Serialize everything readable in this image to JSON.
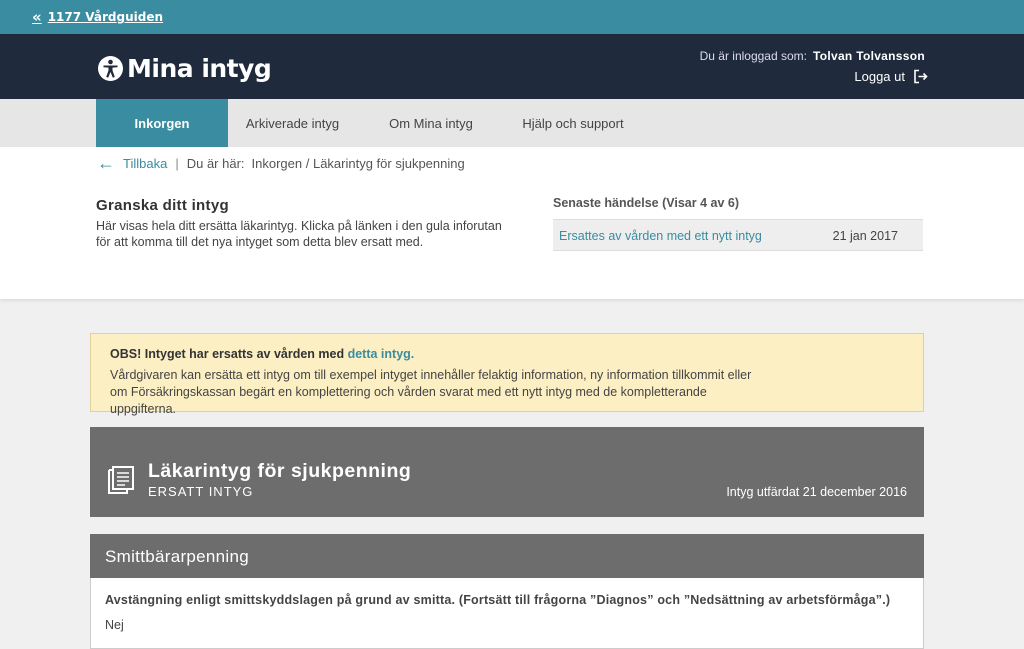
{
  "topbar": {
    "back_label": "1177 Vårdguiden"
  },
  "header": {
    "logo_text": "Mina intyg",
    "logged_in_label": "Du är inloggad som:",
    "user_name": "Tolvan Tolvansson",
    "logout_label": "Logga ut"
  },
  "nav": {
    "tabs": [
      {
        "label": "Inkorgen",
        "active": true
      },
      {
        "label": "Arkiverade intyg",
        "active": false
      },
      {
        "label": "Om Mina intyg",
        "active": false
      },
      {
        "label": "Hjälp och support",
        "active": false
      }
    ]
  },
  "breadcrumb": {
    "back_label": "Tillbaka",
    "separator": "|",
    "here_label": "Du är här:",
    "path": "Inkorgen / Läkarintyg för sjukpenning"
  },
  "review": {
    "title": "Granska ditt intyg",
    "text": "Här visas hela ditt ersätta läkarintyg. Klicka på länken i den gula inforutan för att komma till det nya intyget som detta blev ersatt med."
  },
  "events": {
    "title": "Senaste händelse (Visar 4 av 6)",
    "items": [
      {
        "text": "Ersattes av vården med ett nytt intyg",
        "date": "21 jan 2017"
      }
    ]
  },
  "obs": {
    "head_prefix": "OBS! Intyget har ersatts av vården med",
    "head_link": "detta intyg.",
    "body": "Vårdgivaren kan ersätta ett intyg om till exempel intyget innehåller felaktig information, ny information tillkommit eller om Försäkringskassan begärt en komplettering och vården svarat med ett nytt intyg med de kompletterande uppgifterna."
  },
  "certificate": {
    "icon": "document-icon",
    "title": "Läkarintyg för sjukpenning",
    "status": "ERSATT INTYG",
    "issued": "Intyg utfärdat 21 december 2016"
  },
  "section": {
    "title": "Smittbärarpenning",
    "question": "Avstängning enligt smittskyddslagen på grund av smitta. (Fortsätt till frågorna ”Diagnos” och ”Nedsättning av arbetsförmåga”.)",
    "answer": "Nej"
  },
  "colors": {
    "teal": "#3a8ca0",
    "header_dark": "#1f2a3d",
    "warning_bg": "#fbefc3",
    "panel_grey": "#6d6d6d"
  }
}
